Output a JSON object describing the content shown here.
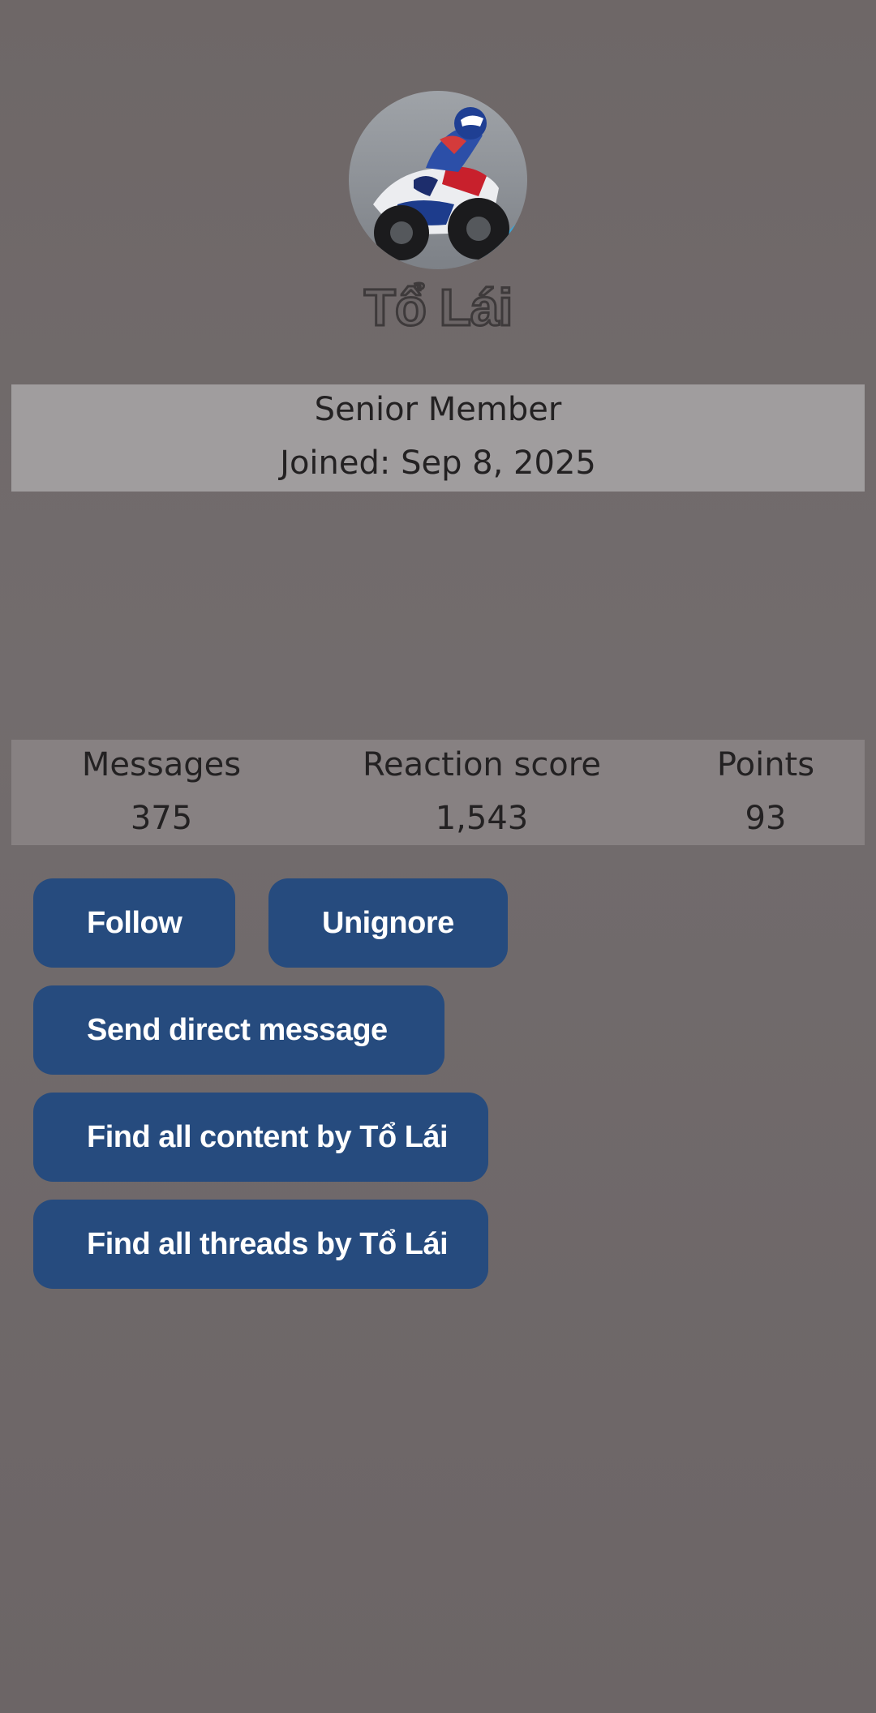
{
  "profile": {
    "avatar": "motorcycle-racer-avatar",
    "username": "Tổ Lái",
    "title": "Senior Member",
    "joined": "Joined: Sep 8, 2025"
  },
  "stats": {
    "messages_label": "Messages",
    "messages_value": "375",
    "reaction_label": "Reaction score",
    "reaction_value": "1,543",
    "points_label": "Points",
    "points_value": "93"
  },
  "actions": {
    "follow": "Follow",
    "unignore": "Unignore",
    "send_dm": "Send direct message",
    "find_content": "Find all content by Tổ Lái",
    "find_threads": "Find all threads by Tổ Lái"
  },
  "colors": {
    "background": "#6f6869",
    "button": "#264b7e",
    "band_light": "#a09d9e",
    "band_stats": "#878182"
  }
}
